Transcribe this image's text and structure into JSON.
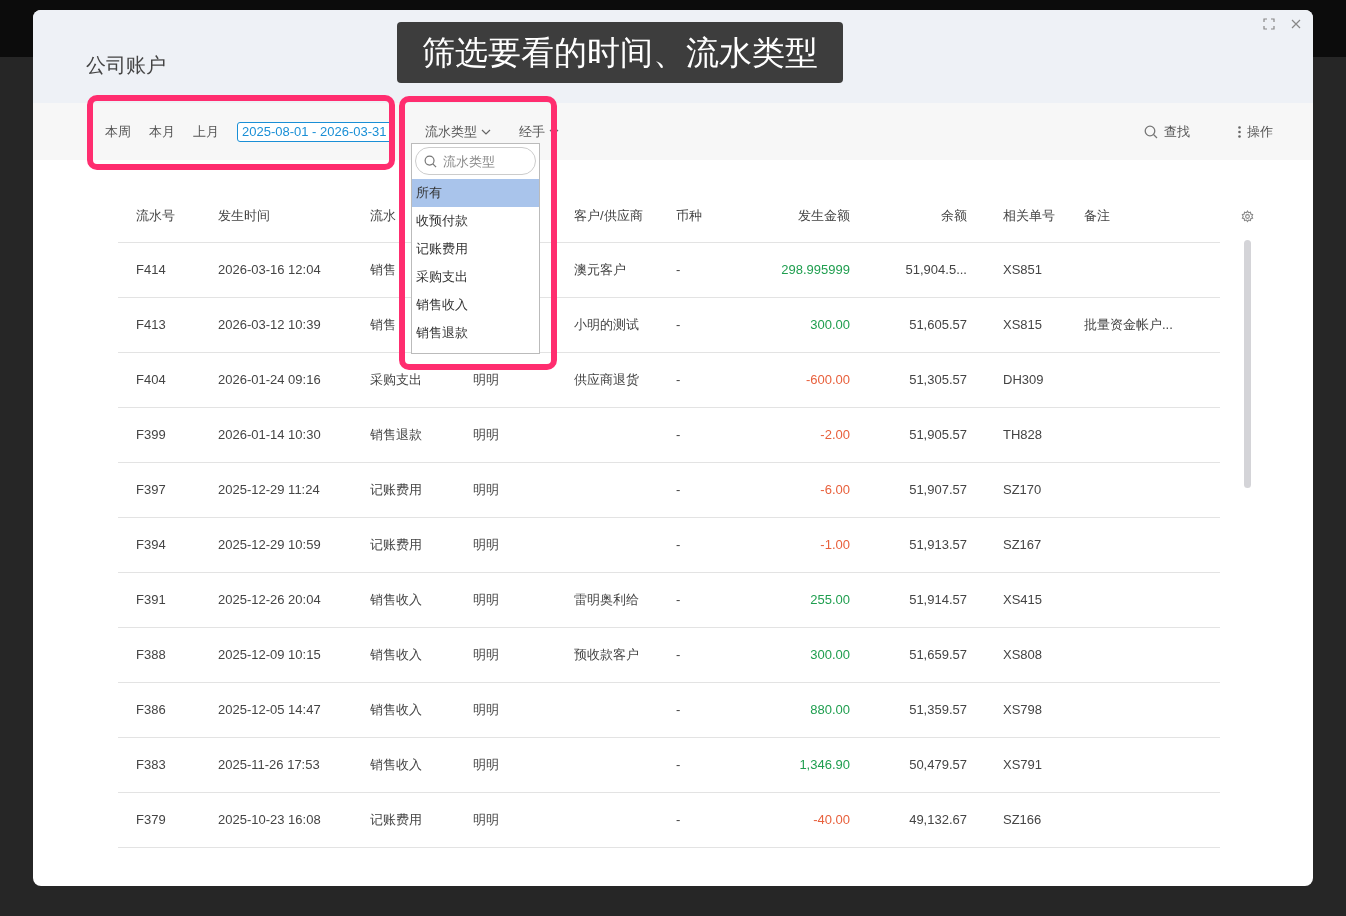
{
  "dialog": {
    "title": "公司账户"
  },
  "callout": {
    "text": "筛选要看的时间、流水类型"
  },
  "highlight_frames": {
    "date_filter": true,
    "type_filter": true
  },
  "toolbar": {
    "periods": [
      {
        "label": "本周",
        "selected": false
      },
      {
        "label": "本月",
        "selected": false
      },
      {
        "label": "上月",
        "selected": false
      }
    ],
    "date_range": "2025-08-01 - 2026-03-31",
    "filters": [
      {
        "label": "流水类型"
      },
      {
        "label": "经手"
      }
    ],
    "search": "查找",
    "actions": "操作"
  },
  "type_dropdown": {
    "placeholder": "流水类型",
    "options": [
      {
        "label": "所有",
        "selected": true
      },
      {
        "label": "收预付款",
        "selected": false
      },
      {
        "label": "记账费用",
        "selected": false
      },
      {
        "label": "采购支出",
        "selected": false
      },
      {
        "label": "销售收入",
        "selected": false
      },
      {
        "label": "销售退款",
        "selected": false
      }
    ]
  },
  "table": {
    "columns": [
      "流水号",
      "发生时间",
      "流水",
      "",
      "客户/供应商",
      "币种",
      "发生金额",
      "余额",
      "相关单号",
      "备注"
    ],
    "rows": [
      {
        "id": "F414",
        "time": "2026-03-16 12:04",
        "type": "销售",
        "handler": "",
        "party": "澳元客户",
        "currency": "-",
        "amount": "298.995999",
        "color": "#1f9e4f",
        "balance": "51,904.5...",
        "ref": "XS851",
        "note": ""
      },
      {
        "id": "F413",
        "time": "2026-03-12 10:39",
        "type": "销售",
        "handler": "",
        "party": "小明的测试",
        "currency": "-",
        "amount": "300.00",
        "color": "#1f9e4f",
        "balance": "51,605.57",
        "ref": "XS815",
        "note": "批量资金帐户..."
      },
      {
        "id": "F404",
        "time": "2026-01-24 09:16",
        "type": "采购支出",
        "handler": "明明",
        "party": "供应商退货",
        "currency": "-",
        "amount": "-600.00",
        "color": "#e8603c",
        "balance": "51,305.57",
        "ref": "DH309",
        "note": ""
      },
      {
        "id": "F399",
        "time": "2026-01-14 10:30",
        "type": "销售退款",
        "handler": "明明",
        "party": "",
        "currency": "-",
        "amount": "-2.00",
        "color": "#e8603c",
        "balance": "51,905.57",
        "ref": "TH828",
        "note": ""
      },
      {
        "id": "F397",
        "time": "2025-12-29 11:24",
        "type": "记账费用",
        "handler": "明明",
        "party": "",
        "currency": "-",
        "amount": "-6.00",
        "color": "#e8603c",
        "balance": "51,907.57",
        "ref": "SZ170",
        "note": ""
      },
      {
        "id": "F394",
        "time": "2025-12-29 10:59",
        "type": "记账费用",
        "handler": "明明",
        "party": "",
        "currency": "-",
        "amount": "-1.00",
        "color": "#e8603c",
        "balance": "51,913.57",
        "ref": "SZ167",
        "note": ""
      },
      {
        "id": "F391",
        "time": "2025-12-26 20:04",
        "type": "销售收入",
        "handler": "明明",
        "party": "雷明奥利给",
        "currency": "-",
        "amount": "255.00",
        "color": "#1f9e4f",
        "balance": "51,914.57",
        "ref": "XS415",
        "note": ""
      },
      {
        "id": "F388",
        "time": "2025-12-09 10:15",
        "type": "销售收入",
        "handler": "明明",
        "party": "预收款客户",
        "currency": "-",
        "amount": "300.00",
        "color": "#1f9e4f",
        "balance": "51,659.57",
        "ref": "XS808",
        "note": ""
      },
      {
        "id": "F386",
        "time": "2025-12-05 14:47",
        "type": "销售收入",
        "handler": "明明",
        "party": "",
        "currency": "-",
        "amount": "880.00",
        "color": "#1f9e4f",
        "balance": "51,359.57",
        "ref": "XS798",
        "note": ""
      },
      {
        "id": "F383",
        "time": "2025-11-26 17:53",
        "type": "销售收入",
        "handler": "明明",
        "party": "",
        "currency": "-",
        "amount": "1,346.90",
        "color": "#1f9e4f",
        "balance": "50,479.57",
        "ref": "XS791",
        "note": ""
      },
      {
        "id": "F379",
        "time": "2025-10-23 16:08",
        "type": "记账费用",
        "handler": "明明",
        "party": "",
        "currency": "-",
        "amount": "-40.00",
        "color": "#e8603c",
        "balance": "49,132.67",
        "ref": "SZ166",
        "note": ""
      }
    ]
  }
}
